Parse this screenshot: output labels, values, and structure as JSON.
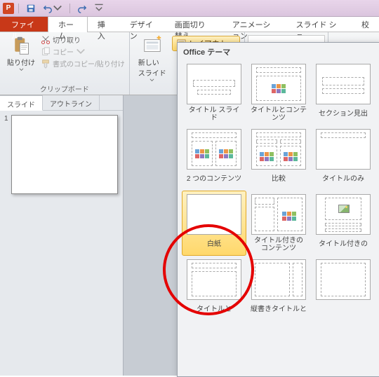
{
  "app": {
    "letter": "P"
  },
  "tabs": {
    "file": "ファイル",
    "home": "ホーム",
    "insert": "挿入",
    "design": "デザイン",
    "transitions": "画面切り替え",
    "animations": "アニメーション",
    "slideshow": "スライド ショー",
    "review": "校"
  },
  "ribbon": {
    "paste": "貼り付け",
    "cut": "切り取り",
    "copy": "コピー",
    "format_painter": "書式のコピー/貼り付け",
    "clipboard_group": "クリップボード",
    "new_slide": "新しい\nスライド",
    "layout": "レイアウト"
  },
  "sidepanel": {
    "tab_slides": "スライド",
    "tab_outline": "アウトライン",
    "thumb_num": "1"
  },
  "gallery": {
    "header": "Office テーマ",
    "items": [
      {
        "label": "タイトル スライド"
      },
      {
        "label": "タイトルとコンテンツ"
      },
      {
        "label": "セクション見出"
      },
      {
        "label": "2 つのコンテンツ"
      },
      {
        "label": "比較"
      },
      {
        "label": "タイトルのみ"
      },
      {
        "label": "白紙"
      },
      {
        "label": "タイトル付きの\nコンテンツ"
      },
      {
        "label": "タイトル付きの"
      },
      {
        "label": "タイトルと"
      },
      {
        "label": "縦書きタイトルと"
      },
      {
        "label": ""
      }
    ]
  }
}
